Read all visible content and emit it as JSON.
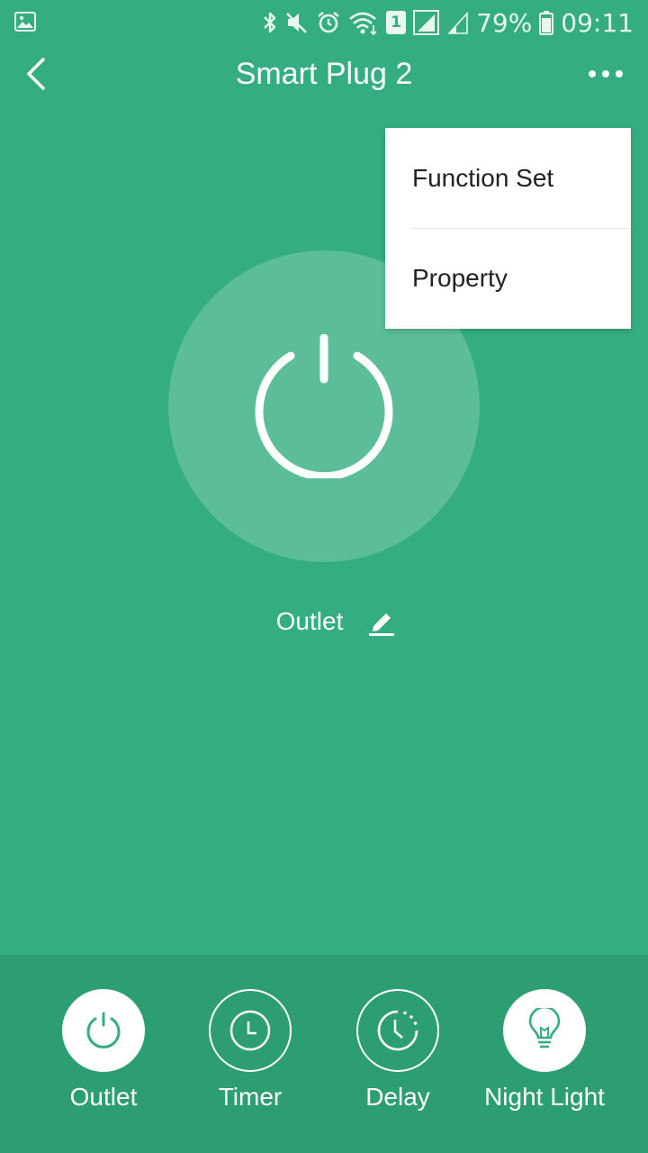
{
  "status_bar": {
    "battery": "79%",
    "time": "09:11",
    "sim_slot": "1"
  },
  "header": {
    "title": "Smart Plug 2"
  },
  "menu": {
    "items": [
      {
        "label": "Function Set"
      },
      {
        "label": "Property"
      }
    ]
  },
  "main": {
    "outlet_name": "Outlet"
  },
  "bottom_bar": {
    "items": [
      {
        "label": "Outlet",
        "icon": "power-icon",
        "active": true
      },
      {
        "label": "Timer",
        "icon": "clock-icon",
        "active": false
      },
      {
        "label": "Delay",
        "icon": "delay-clock-icon",
        "active": false
      },
      {
        "label": "Night Light",
        "icon": "bulb-icon",
        "active": true
      }
    ]
  },
  "colors": {
    "background": "#34ae80",
    "bottom_bar": "#2d9e72",
    "accent": "#34ae80",
    "menu_background": "#ffffff"
  }
}
